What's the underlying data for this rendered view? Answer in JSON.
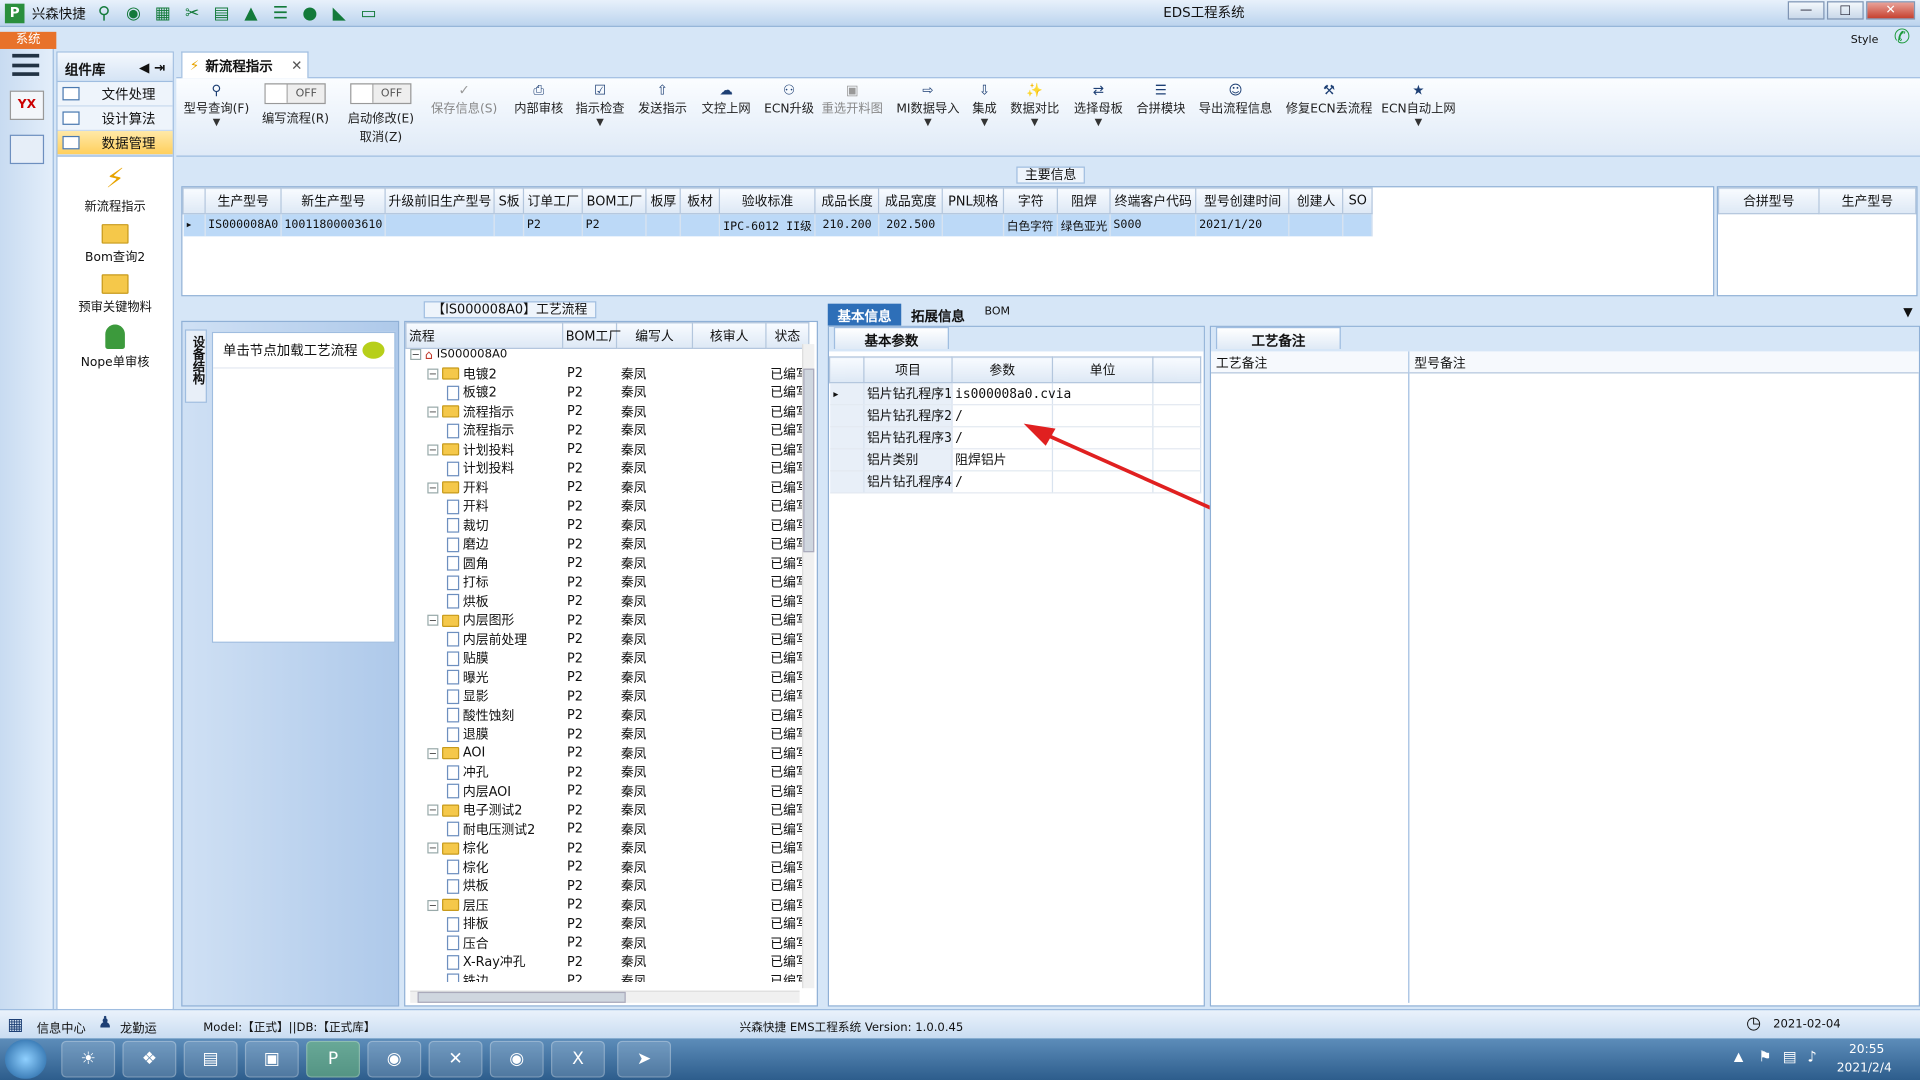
{
  "window": {
    "title": "EDS工程系统",
    "app_name": "兴森快捷",
    "style_label": "Style"
  },
  "system_tab": "系统",
  "nav": {
    "header": "组件库",
    "items": [
      {
        "label": "文件处理"
      },
      {
        "label": "设计算法"
      },
      {
        "label": "数据管理"
      }
    ],
    "launchers": [
      {
        "label": "新流程指示"
      },
      {
        "label": "Bom查询2"
      },
      {
        "label": "预审关键物料"
      },
      {
        "label": "Nope单审核"
      }
    ]
  },
  "doc_tab": {
    "label": "新流程指示"
  },
  "ribbon": {
    "model_query": "型号查询(F)",
    "write_flow": "编写流程(R)",
    "start_modify": "启动修改(E)",
    "cancel": "取消(Z)",
    "toggle_off": "OFF",
    "save_info": "保存信息(S)",
    "internal_review": "内部审核",
    "instruct_check": "指示检查",
    "send_instruct": "发送指示",
    "upload_text": "文控上网",
    "ecn_upgrade": "ECN升级",
    "reupload_map": "重选开料图",
    "mi_import": "MI数据导入",
    "integrate": "集成",
    "data_compare": "数据对比",
    "select_master": "选择母板",
    "merge_module": "合拼模块",
    "export_flow": "导出流程信息",
    "fix_ecn": "修复ECN丢流程",
    "ecn_auto": "ECN自动上网"
  },
  "main_info_caption": "主要信息",
  "top_grid": {
    "columns": [
      "生产型号",
      "新生产型号",
      "升级前旧生产型号",
      "S板",
      "订单工厂",
      "BOM工厂",
      "板厚",
      "板材",
      "验收标准",
      "成品长度",
      "成品宽度",
      "PNL规格",
      "字符",
      "阻焊",
      "终端客户代码",
      "型号创建时间",
      "创建人",
      "SO"
    ],
    "row": [
      "IS000008A0",
      "10011800003610",
      "",
      "",
      "P2",
      "P2",
      "",
      "",
      "IPC-6012 II级",
      "210.200",
      "202.500",
      "",
      "白色字符",
      "绿色亚光",
      "S000",
      "2021/1/20",
      "",
      ""
    ],
    "side_columns": [
      "合拼型号",
      "生产型号"
    ]
  },
  "flow_caption": "【IS000008A0】工艺流程",
  "left_pane": {
    "vertical_tab": "设备结构",
    "balloon": "单击节点加载工艺流程"
  },
  "tree": {
    "columns": [
      "流程",
      "BOM工厂",
      "编写人",
      "核审人",
      "状态"
    ],
    "factory": "P2",
    "writer": "秦凤",
    "status": "已编写",
    "root": "IS000008A0",
    "nodes": [
      {
        "label": "电镀2",
        "level": 1
      },
      {
        "label": "板镀2",
        "level": 2
      },
      {
        "label": "流程指示",
        "level": 1
      },
      {
        "label": "流程指示",
        "level": 2
      },
      {
        "label": "计划投料",
        "level": 1
      },
      {
        "label": "计划投料",
        "level": 2
      },
      {
        "label": "开料",
        "level": 1
      },
      {
        "label": "开料",
        "level": 2
      },
      {
        "label": "裁切",
        "level": 2
      },
      {
        "label": "磨边",
        "level": 2
      },
      {
        "label": "圆角",
        "level": 2
      },
      {
        "label": "打标",
        "level": 2
      },
      {
        "label": "烘板",
        "level": 2
      },
      {
        "label": "内层图形",
        "level": 1
      },
      {
        "label": "内层前处理",
        "level": 2
      },
      {
        "label": "贴膜",
        "level": 2
      },
      {
        "label": "曝光",
        "level": 2
      },
      {
        "label": "显影",
        "level": 2
      },
      {
        "label": "酸性蚀刻",
        "level": 2
      },
      {
        "label": "退膜",
        "level": 2
      },
      {
        "label": "AOI",
        "level": 1
      },
      {
        "label": "冲孔",
        "level": 2
      },
      {
        "label": "内层AOI",
        "level": 2
      },
      {
        "label": "电子测试2",
        "level": 1
      },
      {
        "label": "耐电压测试2",
        "level": 2
      },
      {
        "label": "棕化",
        "level": 1
      },
      {
        "label": "棕化",
        "level": 2
      },
      {
        "label": "烘板",
        "level": 2
      },
      {
        "label": "层压",
        "level": 1
      },
      {
        "label": "排板",
        "level": 2
      },
      {
        "label": "压合",
        "level": 2
      },
      {
        "label": "X-Ray冲孔",
        "level": 2
      },
      {
        "label": "铣边",
        "level": 2
      }
    ]
  },
  "info_tabs": [
    "基本信息",
    "拓展信息",
    "BOM"
  ],
  "param_tab": "基本参数",
  "params": {
    "columns": [
      "项目",
      "参数",
      "单位"
    ],
    "rows": [
      {
        "item": "铝片钻孔程序1",
        "value": "is000008a0.cvia",
        "unit": ""
      },
      {
        "item": "铝片钻孔程序2",
        "value": "/",
        "unit": ""
      },
      {
        "item": "铝片钻孔程序3",
        "value": "/",
        "unit": ""
      },
      {
        "item": "铝片类别",
        "value": "阻焊铝片",
        "unit": ""
      },
      {
        "item": "铝片钻孔程序4",
        "value": "/",
        "unit": ""
      }
    ]
  },
  "remark_tab": "工艺备注",
  "remark_columns": [
    "工艺备注",
    "型号备注"
  ],
  "status": {
    "info_center": "信息中心",
    "user": "龙勤运",
    "model_db": "Model:【正式】||DB:【正式库】",
    "version": "兴森快捷 EMS工程系统 Version: 1.0.0.45",
    "date": "2021-02-04"
  },
  "tray": {
    "time": "20:55",
    "date": "2021/2/4"
  }
}
